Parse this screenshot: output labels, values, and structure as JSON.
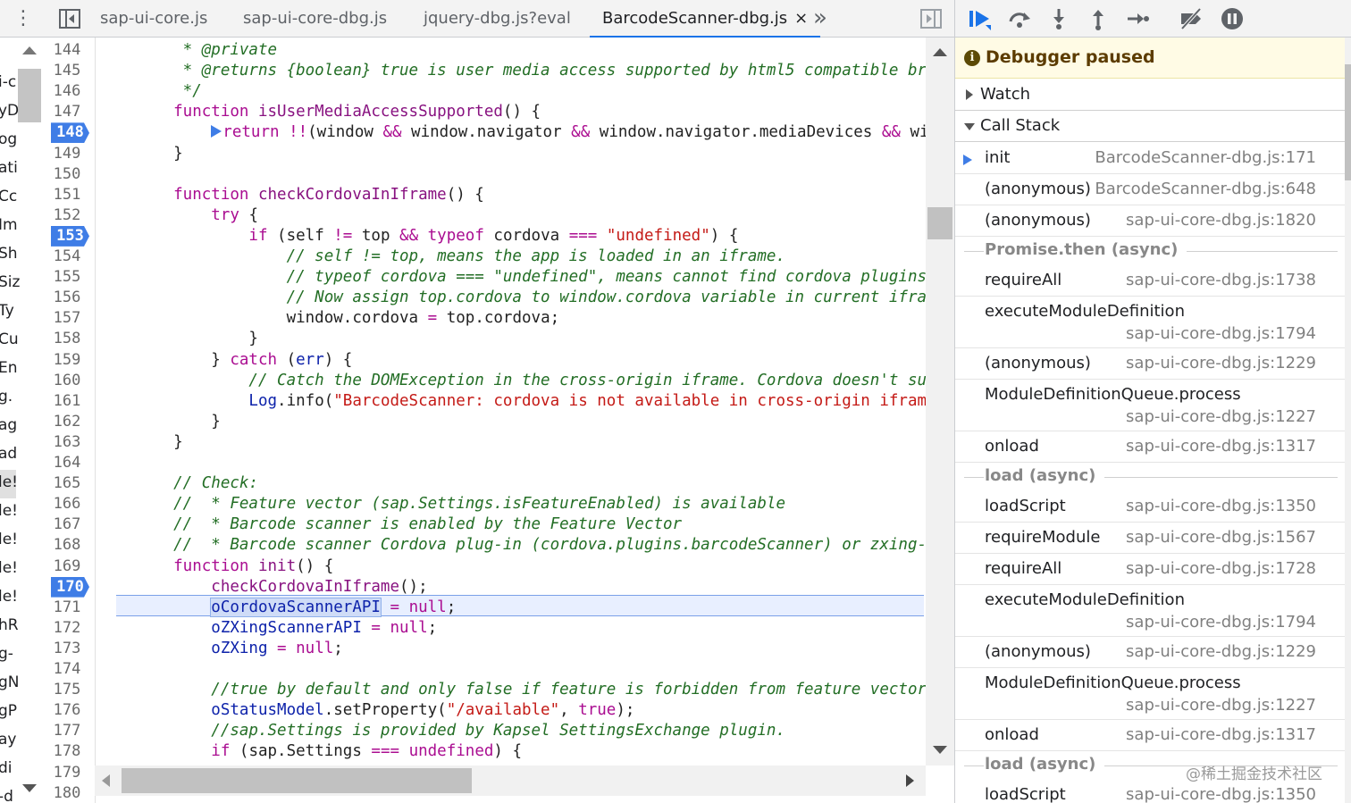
{
  "tabs": [
    {
      "label": "sap-ui-core.js",
      "active": false
    },
    {
      "label": "sap-ui-core-dbg.js",
      "active": false
    },
    {
      "label": "jquery-dbg.js?eval",
      "active": false
    },
    {
      "label": "BarcodeScanner-dbg.js",
      "active": true
    }
  ],
  "tab_close_glyph": "×",
  "more_tabs_glyph": "»",
  "left_strip_fragments": [
    "i-c",
    "yD",
    "og",
    "ati",
    "Cc",
    "Im",
    "Sh",
    "Siz",
    "Ty",
    "Cu",
    "En",
    "g.",
    "ag",
    "ad",
    "le!",
    "le!",
    "le!",
    "le!",
    "le!",
    "hR",
    "g-",
    "gN",
    "gP",
    "ay",
    "di",
    "-d"
  ],
  "editor": {
    "current_line": 171,
    "breakpoints": [
      148,
      153,
      170
    ],
    "lines": [
      {
        "n": 144,
        "tokens": [
          [
            "c",
            "     * @private"
          ]
        ]
      },
      {
        "n": 145,
        "tokens": [
          [
            "c",
            "     * @returns {boolean} true is user media access supported by html5 compatible browse"
          ]
        ]
      },
      {
        "n": 146,
        "tokens": [
          [
            "c",
            "     */"
          ]
        ]
      },
      {
        "n": 147,
        "tokens": [
          [
            "k",
            "    function "
          ],
          [
            "fn",
            "isUserMediaAccessSupported"
          ],
          [
            "p",
            "() {"
          ]
        ]
      },
      {
        "n": 148,
        "tokens": [
          [
            "bparrow",
            ""
          ],
          [
            "k",
            "return "
          ],
          [
            "o",
            "!!"
          ],
          [
            "p",
            "(window "
          ],
          [
            "o",
            "&&"
          ],
          [
            "p",
            " window.navigator "
          ],
          [
            "o",
            "&&"
          ],
          [
            "p",
            " window.navigator.mediaDevices "
          ],
          [
            "o",
            "&&"
          ],
          [
            "p",
            " windo"
          ]
        ],
        "indent": "        "
      },
      {
        "n": 149,
        "tokens": [
          [
            "p",
            "    }"
          ]
        ]
      },
      {
        "n": 150,
        "tokens": [
          [
            "p",
            ""
          ]
        ]
      },
      {
        "n": 151,
        "tokens": [
          [
            "k",
            "    function "
          ],
          [
            "fn",
            "checkCordovaInIframe"
          ],
          [
            "p",
            "() {"
          ]
        ]
      },
      {
        "n": 152,
        "tokens": [
          [
            "k",
            "        try "
          ],
          [
            "p",
            "{"
          ]
        ]
      },
      {
        "n": 153,
        "tokens": [
          [
            "k",
            "            if "
          ],
          [
            "p",
            "(self "
          ],
          [
            "o",
            "!="
          ],
          [
            "p",
            " top "
          ],
          [
            "o",
            "&&"
          ],
          [
            "k",
            " typeof "
          ],
          [
            "p",
            "cordova "
          ],
          [
            "o",
            "==="
          ],
          [
            "s",
            " \"undefined\""
          ],
          [
            "p",
            ") {"
          ]
        ]
      },
      {
        "n": 154,
        "tokens": [
          [
            "c",
            "                // self != top, means the app is loaded in an iframe."
          ]
        ]
      },
      {
        "n": 155,
        "tokens": [
          [
            "c",
            "                // typeof cordova === \"undefined\", means cannot find cordova plugins in"
          ]
        ]
      },
      {
        "n": 156,
        "tokens": [
          [
            "c",
            "                // Now assign top.cordova to window.cordova variable in current iframe."
          ]
        ]
      },
      {
        "n": 157,
        "tokens": [
          [
            "p",
            "                window.cordova "
          ],
          [
            "o",
            "="
          ],
          [
            "p",
            " top.cordova;"
          ]
        ]
      },
      {
        "n": 158,
        "tokens": [
          [
            "p",
            "            }"
          ]
        ]
      },
      {
        "n": 159,
        "tokens": [
          [
            "p",
            "        } "
          ],
          [
            "k",
            "catch "
          ],
          [
            "p",
            "("
          ],
          [
            "v",
            "err"
          ],
          [
            "p",
            ") {"
          ]
        ]
      },
      {
        "n": 160,
        "tokens": [
          [
            "c",
            "            // Catch the DOMException in the cross-origin iframe. Cordova doesn't suppor"
          ]
        ]
      },
      {
        "n": 161,
        "tokens": [
          [
            "v",
            "            Log"
          ],
          [
            "p",
            ".info("
          ],
          [
            "s",
            "\"BarcodeScanner: cordova is not available in cross-origin iframe\""
          ],
          [
            "p",
            ");"
          ]
        ]
      },
      {
        "n": 162,
        "tokens": [
          [
            "p",
            "        }"
          ]
        ]
      },
      {
        "n": 163,
        "tokens": [
          [
            "p",
            "    }"
          ]
        ]
      },
      {
        "n": 164,
        "tokens": [
          [
            "p",
            ""
          ]
        ]
      },
      {
        "n": 165,
        "tokens": [
          [
            "c",
            "    // Check:"
          ]
        ]
      },
      {
        "n": 166,
        "tokens": [
          [
            "c",
            "    //  * Feature vector (sap.Settings.isFeatureEnabled) is available"
          ]
        ]
      },
      {
        "n": 167,
        "tokens": [
          [
            "c",
            "    //  * Barcode scanner is enabled by the Feature Vector"
          ]
        ]
      },
      {
        "n": 168,
        "tokens": [
          [
            "c",
            "    //  * Barcode scanner Cordova plug-in (cordova.plugins.barcodeScanner) or zxing-js ("
          ]
        ]
      },
      {
        "n": 169,
        "tokens": [
          [
            "k",
            "    function "
          ],
          [
            "fn",
            "init"
          ],
          [
            "p",
            "() {"
          ]
        ]
      },
      {
        "n": 170,
        "tokens": [
          [
            "fn",
            "        checkCordovaInIframe"
          ],
          [
            "p",
            "();"
          ]
        ]
      },
      {
        "n": 171,
        "tokens": [
          [
            "p",
            "        "
          ],
          [
            "vhl",
            "oCordovaScannerAPI"
          ],
          [
            "o",
            " ="
          ],
          [
            "lit",
            " null"
          ],
          [
            "p",
            ";"
          ]
        ]
      },
      {
        "n": 172,
        "tokens": [
          [
            "v",
            "        oZXingScannerAPI"
          ],
          [
            "o",
            " ="
          ],
          [
            "lit",
            " null"
          ],
          [
            "p",
            ";"
          ]
        ]
      },
      {
        "n": 173,
        "tokens": [
          [
            "v",
            "        oZXing"
          ],
          [
            "o",
            " ="
          ],
          [
            "lit",
            " null"
          ],
          [
            "p",
            ";"
          ]
        ]
      },
      {
        "n": 174,
        "tokens": [
          [
            "p",
            ""
          ]
        ]
      },
      {
        "n": 175,
        "tokens": [
          [
            "c",
            "        //true by default and only false if feature is forbidden from feature vector"
          ]
        ]
      },
      {
        "n": 176,
        "tokens": [
          [
            "v",
            "        oStatusModel"
          ],
          [
            "p",
            ".setProperty("
          ],
          [
            "s",
            "\"/available\""
          ],
          [
            "p",
            ", "
          ],
          [
            "lit",
            "true"
          ],
          [
            "p",
            ");"
          ]
        ]
      },
      {
        "n": 177,
        "tokens": [
          [
            "c",
            "        //sap.Settings is provided by Kapsel SettingsExchange plugin."
          ]
        ]
      },
      {
        "n": 178,
        "tokens": [
          [
            "k",
            "        if "
          ],
          [
            "p",
            "(sap.Settings "
          ],
          [
            "o",
            "==="
          ],
          [
            "lit",
            " undefined"
          ],
          [
            "p",
            ") {"
          ]
        ]
      },
      {
        "n": 179,
        "tokens": [
          [
            "c",
            "            // ·  ·   ·  ·    ·  ·  ·    ·   ·  ·  ·   ·   ·   ·  ·  ·  ·   ·"
          ]
        ]
      },
      {
        "n": 180,
        "tokens": [
          [
            "p",
            ""
          ]
        ]
      }
    ]
  },
  "debugger": {
    "toolbar": [
      {
        "name": "resume-icon",
        "title": "Resume"
      },
      {
        "name": "step-over-icon",
        "title": "Step over"
      },
      {
        "name": "step-into-icon",
        "title": "Step into"
      },
      {
        "name": "step-out-icon",
        "title": "Step out"
      },
      {
        "name": "step-icon",
        "title": "Step"
      },
      {
        "name": "deactivate-breakpoints-icon",
        "title": "Deactivate breakpoints"
      },
      {
        "name": "pause-on-exceptions-icon",
        "title": "Pause on exceptions"
      }
    ],
    "paused_label": "Debugger paused",
    "watch_label": "Watch",
    "callstack_label": "Call Stack",
    "frames": [
      {
        "type": "frame",
        "name": "init",
        "loc": "BarcodeScanner-dbg.js:171",
        "current": true
      },
      {
        "type": "frame",
        "name": "(anonymous)",
        "loc": "BarcodeScanner-dbg.js:648"
      },
      {
        "type": "frame",
        "name": "(anonymous)",
        "loc": "sap-ui-core-dbg.js:1820"
      },
      {
        "type": "async",
        "name": "Promise.then (async)"
      },
      {
        "type": "frame",
        "name": "requireAll",
        "loc": "sap-ui-core-dbg.js:1738"
      },
      {
        "type": "frame2",
        "name": "executeModuleDefinition",
        "loc": "sap-ui-core-dbg.js:1794"
      },
      {
        "type": "frame",
        "name": "(anonymous)",
        "loc": "sap-ui-core-dbg.js:1229"
      },
      {
        "type": "frame2",
        "name": "ModuleDefinitionQueue.process",
        "loc": "sap-ui-core-dbg.js:1227"
      },
      {
        "type": "frame",
        "name": "onload",
        "loc": "sap-ui-core-dbg.js:1317"
      },
      {
        "type": "async",
        "name": "load (async)"
      },
      {
        "type": "frame",
        "name": "loadScript",
        "loc": "sap-ui-core-dbg.js:1350"
      },
      {
        "type": "frame",
        "name": "requireModule",
        "loc": "sap-ui-core-dbg.js:1567"
      },
      {
        "type": "frame",
        "name": "requireAll",
        "loc": "sap-ui-core-dbg.js:1728"
      },
      {
        "type": "frame2",
        "name": "executeModuleDefinition",
        "loc": "sap-ui-core-dbg.js:1794"
      },
      {
        "type": "frame",
        "name": "(anonymous)",
        "loc": "sap-ui-core-dbg.js:1229"
      },
      {
        "type": "frame2",
        "name": "ModuleDefinitionQueue.process",
        "loc": "sap-ui-core-dbg.js:1227"
      },
      {
        "type": "frame",
        "name": "onload",
        "loc": "sap-ui-core-dbg.js:1317"
      },
      {
        "type": "async",
        "name": "load (async)"
      },
      {
        "type": "frame",
        "name": "loadScript",
        "loc": "sap-ui-core-dbg.js:1350"
      }
    ]
  },
  "watermark": "@稀土掘金技术社区",
  "colors": {
    "breakpoint": "#3f7de6",
    "paused_bg": "#fffbe5",
    "current_line_bg": "#e8efff"
  }
}
